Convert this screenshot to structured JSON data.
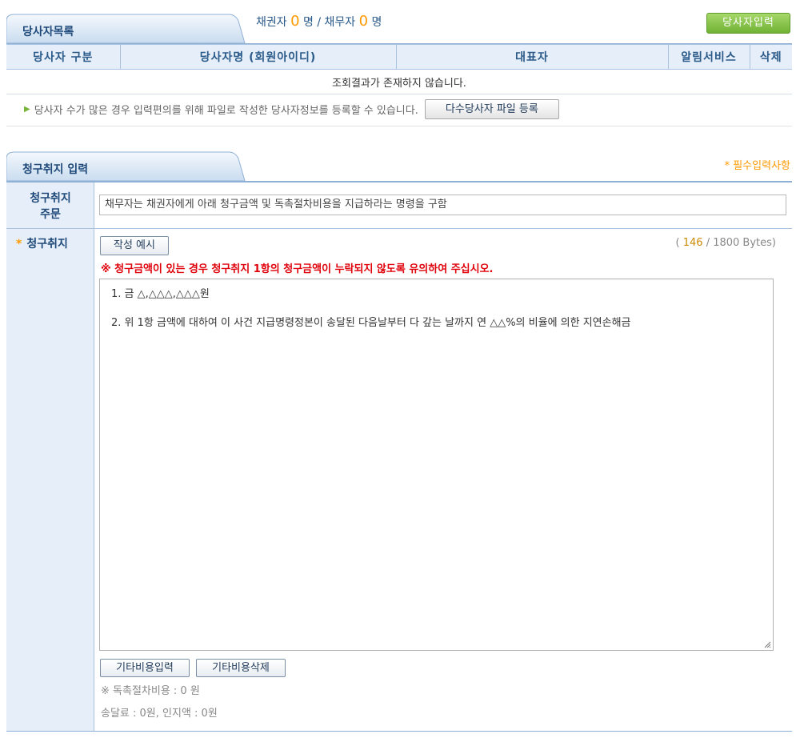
{
  "party_list": {
    "tab_title": "당사자목록",
    "counts": {
      "creditor_label": "채권자",
      "creditor_count": "0",
      "debtor_label": "/ 채무자",
      "debtor_count": "0",
      "unit": "명"
    },
    "add_button": "당사자입력",
    "columns": [
      "당사자 구분",
      "당사자명 (회원아이디)",
      "대표자",
      "알림서비스",
      "삭제"
    ],
    "empty_message": "조회결과가 존재하지 않습니다.",
    "bulk_note": "당사자 수가 많은 경우 입력편의를 위해 파일로 작성한 당사자정보를 등록할 수 있습니다.",
    "bulk_button": "다수당사자 파일 등록"
  },
  "claim_purpose": {
    "tab_title": "청구취지 입력",
    "required_note": "* 필수입력사항",
    "summary_label_line1": "청구취지",
    "summary_label_line2": "주문",
    "summary_value": "채무자는 채권자에게 아래 청구금액 및 독촉절차비용을 지급하라는 명령을 구함",
    "purpose_label": "청구취지",
    "required_star": "*",
    "example_button": "작성 예시",
    "bytes": {
      "open": "(",
      "current": "146",
      "sep": "/",
      "max": "1800 Bytes)"
    },
    "warning": "※ 청구금액이 있는 경우 청구취지 1항의 청구금액이 누락되지 않도록 유의하여 주십시오.",
    "text_line1": "1. 금  △,△△△,△△△원",
    "text_line2": "2. 위 1항 금액에 대하여 이 사건 지급명령정본이 송달된 다음날부터 다 갚는 날까지 연 △△%의 비율에 의한 지연손해금",
    "other_cost_input_button": "기타비용입력",
    "other_cost_delete_button": "기타비용삭제",
    "procedure_cost": "※ 독촉절차비용 : 0 원",
    "delivery_stamp": "송달료 : 0원, 인지액 : 0원"
  }
}
